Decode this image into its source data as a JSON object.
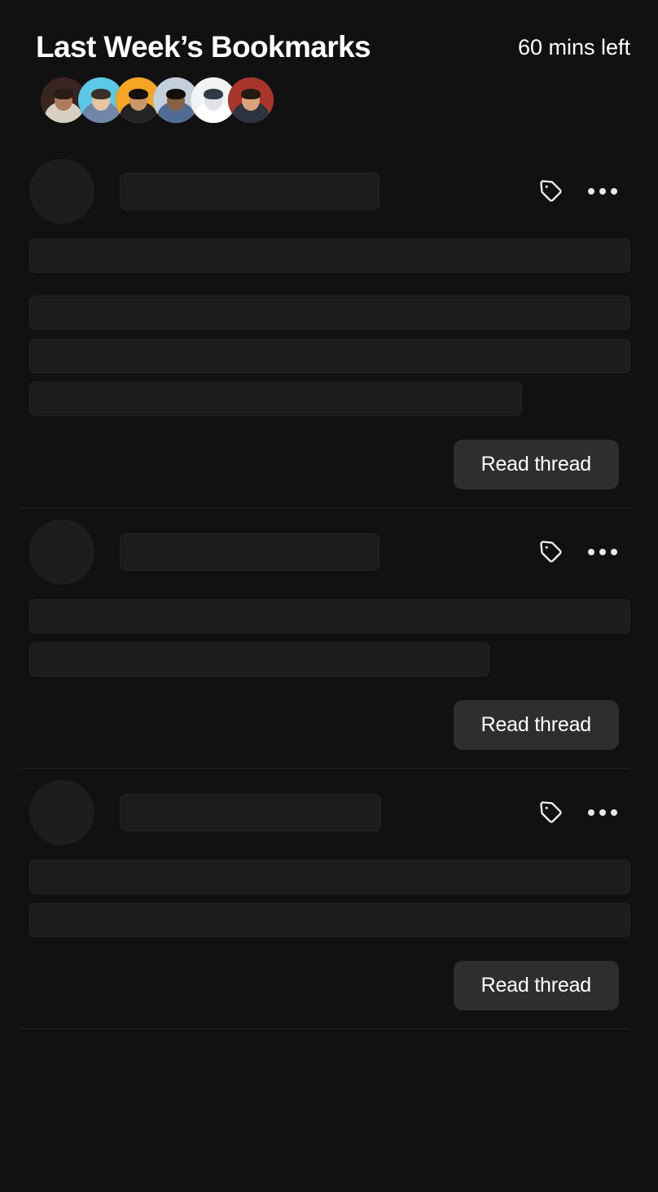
{
  "header": {
    "title": "Last Week’s Bookmarks",
    "time_left": "60 mins left"
  },
  "avatars": [
    {
      "name": "avatar-1",
      "bg": "#3a2420",
      "skin": "#b07a5c",
      "shirt": "#d8cfc0",
      "hair": "#2a1c16"
    },
    {
      "name": "avatar-2",
      "bg": "#5bc8e8",
      "skin": "#e8c3a4",
      "shirt": "#6f86a8",
      "hair": "#3a3026"
    },
    {
      "name": "avatar-3",
      "bg": "#f5a623",
      "skin": "#c9956a",
      "shirt": "#232323",
      "hair": "#15100c"
    },
    {
      "name": "avatar-4",
      "bg": "#c3cfdd",
      "skin": "#8a6040",
      "shirt": "#4f6d92",
      "hair": "#140f0b"
    },
    {
      "name": "avatar-5",
      "bg": "#f2f3f5",
      "skin": "#dfe3e8",
      "shirt": "#ffffff",
      "hair": "#2e3a46"
    },
    {
      "name": "avatar-6",
      "bg": "#a8352c",
      "skin": "#d9a47c",
      "shirt": "#2b3440",
      "hair": "#241a12"
    }
  ],
  "icons": {
    "tag": "tag-icon",
    "more": "more-options-icon"
  },
  "cards": [
    {
      "read_button_label": "Read thread",
      "name_bar_width": 319,
      "lines": [
        {
          "width": "100%",
          "group": 1
        },
        {
          "width": "100%",
          "group": 2
        },
        {
          "width": "100%",
          "group": 2
        },
        {
          "width": "82%",
          "group": 2
        }
      ]
    },
    {
      "read_button_label": "Read thread",
      "name_bar_width": 319,
      "lines": [
        {
          "width": "100%",
          "group": 1
        },
        {
          "width": "76.5%",
          "group": 1
        }
      ]
    },
    {
      "read_button_label": "Read thread",
      "name_bar_width": 321,
      "lines": [
        {
          "width": "100%",
          "group": 1
        },
        {
          "width": "100%",
          "group": 1
        }
      ]
    }
  ],
  "colors": {
    "background": "#111111",
    "skeleton": "#1c1c1c",
    "skeleton_border": "#232323",
    "skeleton_avatar": "#1d1d1d",
    "button_bg": "#2e2e2e",
    "divider": "#232323",
    "text": "#ffffff"
  }
}
